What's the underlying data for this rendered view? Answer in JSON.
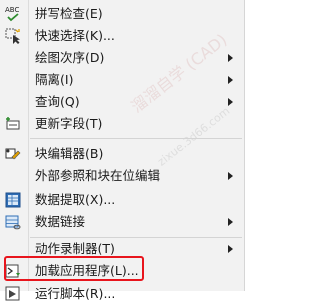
{
  "menu": {
    "items": [
      {
        "label": "拼写检查(E)",
        "submenu": false,
        "icon": "spellcheck-abc-icon"
      },
      {
        "label": "快速选择(K)...",
        "submenu": false,
        "icon": "quick-select-icon"
      },
      {
        "label": "绘图次序(D)",
        "submenu": true
      },
      {
        "label": "隔离(I)",
        "submenu": true
      },
      {
        "label": "查询(Q)",
        "submenu": true
      },
      {
        "label": "更新字段(T)",
        "submenu": false,
        "icon": "update-field-icon"
      },
      {
        "label": "块编辑器(B)",
        "submenu": false,
        "icon": "block-editor-icon"
      },
      {
        "label": "外部参照和块在位编辑",
        "submenu": true
      },
      {
        "label": "数据提取(X)...",
        "submenu": false,
        "icon": "data-extraction-icon"
      },
      {
        "label": "数据链接",
        "submenu": true,
        "icon": "data-link-icon"
      },
      {
        "label": "动作录制器(T)",
        "submenu": true
      },
      {
        "label": "加载应用程序(L)...",
        "submenu": false,
        "icon": "load-application-icon"
      },
      {
        "label": "运行脚本(R)...",
        "submenu": false,
        "icon": "run-script-icon"
      }
    ]
  },
  "watermark": {
    "text": "溜溜自学 (CAD)",
    "url": "zixue.3d66.com"
  },
  "colors": {
    "menu_bg": "#f2f2f2",
    "highlight_border": "#e8151d",
    "text": "#1a1a1a"
  }
}
